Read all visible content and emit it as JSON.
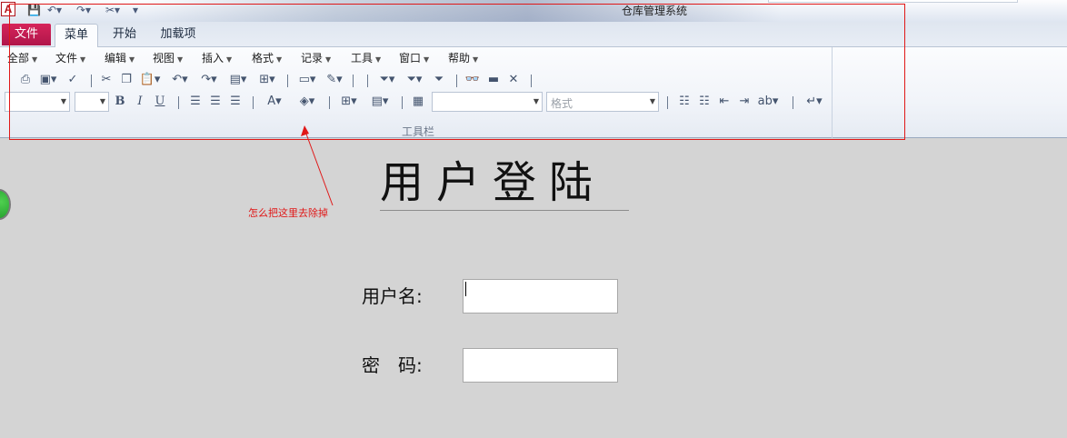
{
  "window": {
    "title": "仓库管理系统",
    "app_icon_letter": "A"
  },
  "tabs": {
    "file": "文件",
    "items": [
      "菜单",
      "开始",
      "加载项"
    ],
    "active_index": 0
  },
  "menubar": {
    "items": [
      "全部",
      "文件",
      "编辑",
      "视图",
      "插入",
      "格式",
      "记录",
      "工具",
      "窗口",
      "帮助"
    ]
  },
  "ribbon": {
    "group_label": "工具栏",
    "format_combo_placeholder": "格式"
  },
  "annotation": {
    "note": "怎么把这里去除掉",
    "color": "#e01818"
  },
  "form": {
    "title": "用户登陆",
    "username_label": "用户名:",
    "password_label": "密　码:",
    "username_value": "",
    "password_value": ""
  },
  "colors": {
    "file_tab": "#c41a52",
    "background": "#d4d4d4",
    "green_button": "#2eb83a"
  }
}
